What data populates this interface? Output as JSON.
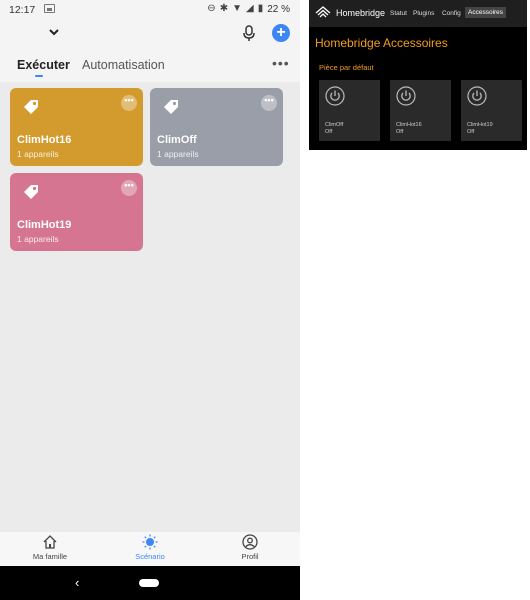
{
  "statusbar": {
    "time": "12:17",
    "battery": "22 %"
  },
  "tabs": {
    "execute": "Exécuter",
    "automation": "Automatisation",
    "more": "•••"
  },
  "colors": {
    "accent": "#3d86f5",
    "card_yellow": "#d39a2d",
    "card_gray": "#9a9ea8",
    "card_pink": "#d57592",
    "hb_orange": "#f39d1e"
  },
  "cards": [
    {
      "name": "ClimHot16",
      "sub": "1 appareils",
      "icon": "tag-icon",
      "color": "#d39a2d"
    },
    {
      "name": "ClimOff",
      "sub": "1 appareils",
      "icon": "tag-icon",
      "color": "#9a9ea8"
    },
    {
      "name": "ClimHot19",
      "sub": "1 appareils",
      "icon": "tag-icon",
      "color": "#d57592"
    }
  ],
  "bottomnav": [
    {
      "label": "Ma famille",
      "icon": "home-icon"
    },
    {
      "label": "Scénario",
      "icon": "sun-icon"
    },
    {
      "label": "Profil",
      "icon": "profile-icon"
    }
  ],
  "homebridge": {
    "title": "Homebridge",
    "nav": [
      "Statut",
      "Plugins",
      "Config",
      "Accessoires"
    ],
    "heading": "Homebridge Accessoires",
    "room": "Pièce par défaut",
    "tiles": [
      {
        "name": "ClimOff",
        "state": "Off"
      },
      {
        "name": "ClimHot16",
        "state": "Off"
      },
      {
        "name": "ClimHot19",
        "state": "Off"
      }
    ]
  }
}
